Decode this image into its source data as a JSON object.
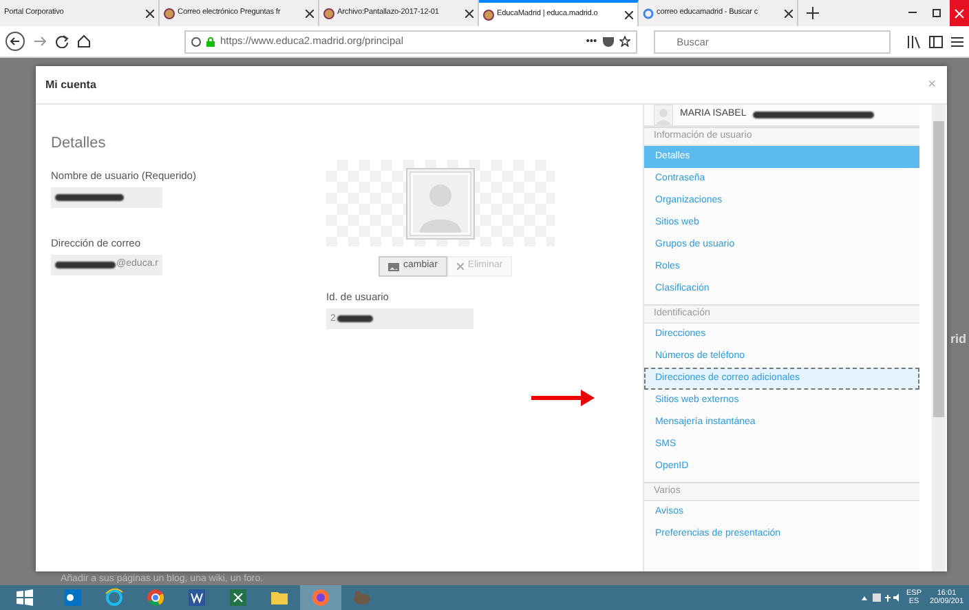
{
  "browser": {
    "tabs": [
      {
        "label": "Portal Corporativo",
        "kind": "plain",
        "selected": false
      },
      {
        "label": "Correo electrónico Preguntas fr",
        "kind": "site",
        "selected": false
      },
      {
        "label": "Archivo:Pantallazo-2017-12-01",
        "kind": "site",
        "selected": false
      },
      {
        "label": "EducaMadrid | educa.madrid.o",
        "kind": "site",
        "selected": true
      },
      {
        "label": "correo educamadrid - Buscar c",
        "kind": "google",
        "selected": false
      }
    ],
    "address": "https://www.educa2.madrid.org/principal",
    "more": "•••",
    "search": {
      "placeholder": "Buscar"
    }
  },
  "background": {
    "side_text": "rid",
    "bottom_text": "Añadir a sus páginas un blog, una wiki, un foro."
  },
  "modal": {
    "title": "Mi cuenta",
    "close": "×",
    "details": {
      "heading": "Detalles",
      "fields": [
        {
          "label": "Nombre de usuario (Requerido)",
          "redacted": true
        },
        {
          "label": "Dirección de correo",
          "value": "@educa.r",
          "redacted": true
        }
      ]
    },
    "photo_buttons": [
      {
        "label": "cambiar",
        "kind": "change",
        "disabled": false
      },
      {
        "label": "Eliminar",
        "kind": "remove",
        "disabled": true
      }
    ],
    "user_id": {
      "label": "Id. de usuario",
      "value": "2",
      "redacted": true
    },
    "sidebar": {
      "user_name": "MARIA ISABEL",
      "redacted": true,
      "sections": [
        {
          "title": "Información de usuario",
          "items": [
            {
              "label": "Detalles",
              "selected": true,
              "focused": false
            },
            {
              "label": "Contraseña",
              "selected": false,
              "focused": false
            },
            {
              "label": "Organizaciones",
              "selected": false,
              "focused": false
            },
            {
              "label": "Sitios web",
              "selected": false,
              "focused": false
            },
            {
              "label": "Grupos de usuario",
              "selected": false,
              "focused": false
            },
            {
              "label": "Roles",
              "selected": false,
              "focused": false
            },
            {
              "label": "Clasificación",
              "selected": false,
              "focused": false
            }
          ]
        },
        {
          "title": "Identificación",
          "items": [
            {
              "label": "Direcciones",
              "selected": false,
              "focused": false
            },
            {
              "label": "Números de teléfono",
              "selected": false,
              "focused": false
            },
            {
              "label": "Direcciones de correo adicionales",
              "selected": false,
              "focused": true
            },
            {
              "label": "Sitios web externos",
              "selected": false,
              "focused": false
            },
            {
              "label": "Mensajería instantánea",
              "selected": false,
              "focused": false
            },
            {
              "label": "SMS",
              "selected": false,
              "focused": false
            },
            {
              "label": "OpenID",
              "selected": false,
              "focused": false
            }
          ]
        },
        {
          "title": "Varios",
          "items": [
            {
              "label": "Avisos",
              "selected": false,
              "focused": false
            },
            {
              "label": "Preferencias de presentación",
              "selected": false,
              "focused": false
            }
          ]
        }
      ]
    }
  },
  "taskbar": {
    "apps": [
      {
        "kind": "outlook",
        "active": false
      },
      {
        "kind": "ie",
        "active": false
      },
      {
        "kind": "chrome",
        "active": false
      },
      {
        "kind": "word",
        "active": false
      },
      {
        "kind": "excel",
        "active": false
      },
      {
        "kind": "folder",
        "active": false
      },
      {
        "kind": "firefox",
        "active": true
      },
      {
        "kind": "gimp",
        "active": false
      }
    ],
    "language": [
      "ESP",
      "ES"
    ],
    "time": "16:01",
    "date": "20/09/201"
  }
}
